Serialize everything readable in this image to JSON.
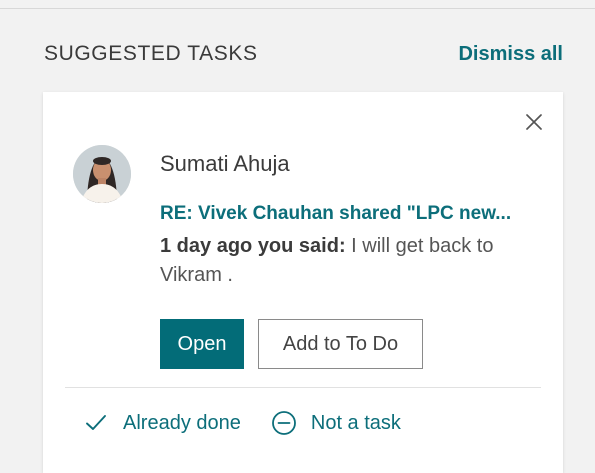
{
  "panel": {
    "title": "SUGGESTED TASKS",
    "dismiss_all": "Dismiss all"
  },
  "card": {
    "close_icon": "close-icon",
    "avatar_icon": "profile-photo",
    "sender_name": "Sumati Ahuja",
    "subject": "RE: Vivek Chauhan shared \"LPC new...",
    "snippet_prefix": "1 day ago you said:",
    "snippet_text": " I will get back to Vikram .",
    "open_button": "Open",
    "todo_button": "Add to To Do",
    "already_done_icon": "checkmark-icon",
    "already_done": "Already done",
    "not_task_icon": "minus-circle-icon",
    "not_task": "Not a task"
  },
  "colors": {
    "accent": "#0c6e7a",
    "primary_button": "#036c78",
    "background": "#f2f2f2",
    "card": "#ffffff"
  }
}
